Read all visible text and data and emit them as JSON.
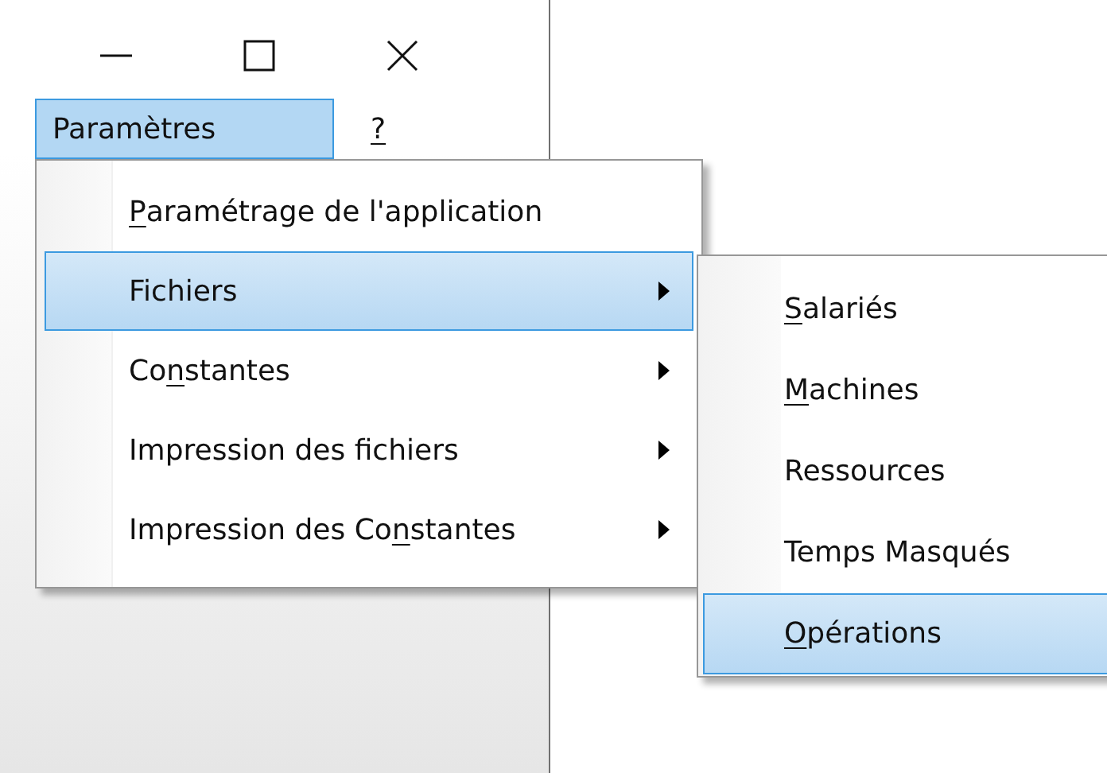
{
  "window_controls": [
    {
      "kind": "minimize"
    },
    {
      "kind": "maximize"
    },
    {
      "kind": "close"
    }
  ],
  "menu_bar": [
    {
      "after": "Paramètres",
      "selected": true
    },
    {
      "key": "?",
      "selected": false
    }
  ],
  "menu": [
    {
      "key": "P",
      "after": "aramétrage de l'application",
      "submenu": false,
      "selected": false
    },
    {
      "before": "Fichiers",
      "submenu": true,
      "selected": true
    },
    {
      "before": "Co",
      "key": "n",
      "after": "stantes",
      "submenu": true,
      "selected": false
    },
    {
      "before": "Impression des fichiers",
      "submenu": true,
      "selected": false
    },
    {
      "before": "Impression des Co",
      "key": "n",
      "after": "stantes",
      "submenu": true,
      "selected": false
    }
  ],
  "submenu": [
    {
      "key": "S",
      "after": "alariés",
      "selected": false
    },
    {
      "key": "M",
      "after": "achines",
      "selected": false
    },
    {
      "before": "Ressources",
      "selected": false
    },
    {
      "before": "Temps Masqués",
      "selected": false
    },
    {
      "key": "O",
      "after": "pérations",
      "selected": true
    }
  ]
}
